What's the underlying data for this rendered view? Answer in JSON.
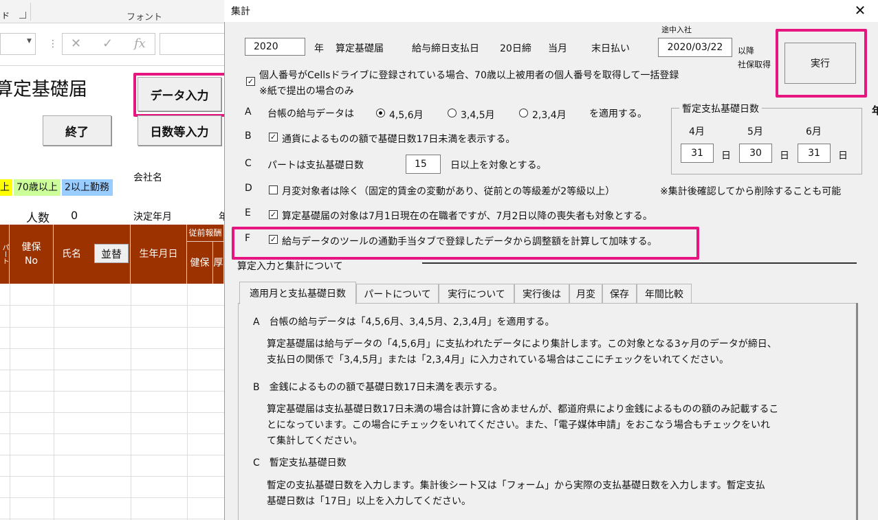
{
  "excel": {
    "ribbon_fragment": "ド",
    "ribbon_font_group": "フォント",
    "formula_cancel": "✕",
    "formula_enter": "✓",
    "formula_fx": "fx",
    "sheet_title": "算定基礎届",
    "btn_data_input": "データ入力",
    "btn_end": "終了",
    "btn_days_input": "日数等入力",
    "company_label": "会社名",
    "legend": [
      {
        "text": "上",
        "color": "#ffff00"
      },
      {
        "text": "70歳以上",
        "color": "#ccff99"
      },
      {
        "text": "2以上勤務",
        "color": "#99ccff"
      }
    ],
    "count_label": "人数",
    "count_value": "0",
    "decision_year": "決定年月",
    "decision_fragment": "年",
    "headers": {
      "part": "パート",
      "health_no": "健保No",
      "name": "氏名",
      "sort_btn": "並替",
      "birthdate": "生年月日",
      "prev_top": "従前報酬",
      "health": "健保",
      "pension": "厚"
    }
  },
  "dialog": {
    "title": "集計",
    "year": "2020",
    "year_unit": "年",
    "form_name": "算定基礎届",
    "pay_label": "給与締日支払日",
    "cutoff": "20日締",
    "month": "当月",
    "end_pay": "末日払い",
    "midjoin_label": "途中入社",
    "midjoin_date": "2020/03/22",
    "after_label": "以降",
    "acq_label": "社保取得",
    "run_button": "実行",
    "mynumber_label": "個人番号がCellsドライブに登録されている場合、70歳以上被用者の個人番号を取得して一括登録",
    "mynumber_note": "※紙で提出の場合のみ",
    "a_letter": "A",
    "a_text": "台帳の給与データは",
    "a_options": [
      "4,5,6月",
      "3,4,5月",
      "2,3,4月"
    ],
    "a_suffix": "を適用する。",
    "b_letter": "B",
    "b_text": "通貨によるものの額で基礎日数17日未満を表示する。",
    "c_letter": "C",
    "c_text": "パートは支払基礎日数",
    "c_value": "15",
    "c_suffix": "日以上を対象とする。",
    "d_letter": "D",
    "d_text": "月変対象者は除く（固定的賃金の変動があり、従前との等級差が2等級以上）",
    "d_note": "※集計後確認してから削除することも可能",
    "e_letter": "E",
    "e_text": "算定基礎届の対象は7月1日現在の在職者ですが、7月2日以降の喪失者も対象とする。",
    "f_letter": "F",
    "f_text": "給与データのツールの通勤手当タブで登録したデータから調整額を計算して加味する。",
    "prov": {
      "title": "暫定支払基礎日数",
      "months": [
        "4月",
        "5月",
        "6月"
      ],
      "values": [
        "31",
        "30",
        "31"
      ],
      "unit": "日"
    },
    "help_header": "算定入力と集計について",
    "tabs": [
      "適用月と支払基礎日数",
      "パートについて",
      "実行について",
      "実行後は",
      "月変",
      "保存",
      "年間比較"
    ],
    "help": {
      "a_title": "A　台帳の給与データは「4,5,6月、3,4,5月、2,3,4月」を適用する。",
      "a_body1": "算定基礎届は給与データの「4,5,6月」に支払われたデータにより集計します。この対象となる3ヶ月のデータが締日、",
      "a_body2": "支払日の関係で「3,4,5月」または「2,3,4月」に入力されている場合はここにチェックをいれてください。",
      "b_title": "B　金銭によるものの額で基礎日数17日未満を表示する。",
      "b_body1": "算定基礎届は支払基礎日数17日未満の場合は計算に含めませんが、都道府県により金銭によるものの額のみ記載するこ",
      "b_body2": "とになっています。この場合にチェックをいれてください。また、「電子媒体申請」をおこなう場合もチェックをいれ",
      "b_body3": "て集計してください。",
      "c_title": "C　暫定支払基礎日数",
      "c_body1": "暫定の支払基礎日数を入力します。集計後シート又は「フォーム」から実際の支払基礎日数を入力します。暫定支払",
      "c_body2": "基礎日数は「17日」以上を入力してください。"
    },
    "edge_char": "年"
  }
}
